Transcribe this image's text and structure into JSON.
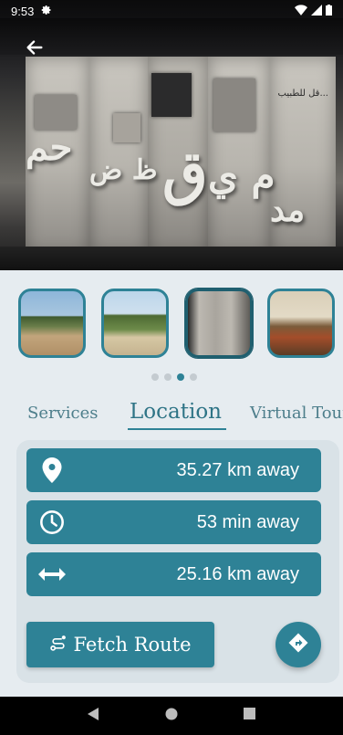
{
  "status_bar": {
    "time": "9:53"
  },
  "hero": {
    "glyph_left": "حم",
    "glyph_center": "م ي",
    "plaque_text": "قل للطبيب..."
  },
  "thumbnails": [
    {
      "name": "thumb-stairs",
      "colors": [
        "#8db6d9",
        "#c2a57c",
        "#6a7e4a"
      ]
    },
    {
      "name": "thumb-garden",
      "colors": [
        "#bcd6ea",
        "#6d8b4a",
        "#d6c7a4"
      ]
    },
    {
      "name": "thumb-exhibit",
      "colors": [
        "#2a2a2a",
        "#bdb9b1",
        "#5e5c58"
      ]
    },
    {
      "name": "thumb-interior",
      "colors": [
        "#d9cfb8",
        "#7a5b3a",
        "#a44d2a"
      ]
    }
  ],
  "pager": {
    "count": 4,
    "active_index": 2
  },
  "tabs": {
    "services": "Services",
    "location": "Location",
    "virtual_tour": "Virtual Tour",
    "active": "location"
  },
  "location_info": {
    "distance": "35.27 km away",
    "duration": "53 min away",
    "straight_distance": "25.16 km away"
  },
  "actions": {
    "fetch_route": "Fetch Route"
  },
  "colors": {
    "accent": "#2e8296",
    "accent_dark": "#1f5f6f",
    "tab_text": "#4d7e8b",
    "card_bg": "#d9e2e7",
    "page_bg": "#e6ecf0"
  },
  "icons": {
    "back": "arrow-left-icon",
    "distance": "location-pin-icon",
    "duration": "clock-icon",
    "straight_distance": "horizontal-arrows-icon",
    "fetch_route": "route-icon",
    "directions": "directions-icon"
  }
}
